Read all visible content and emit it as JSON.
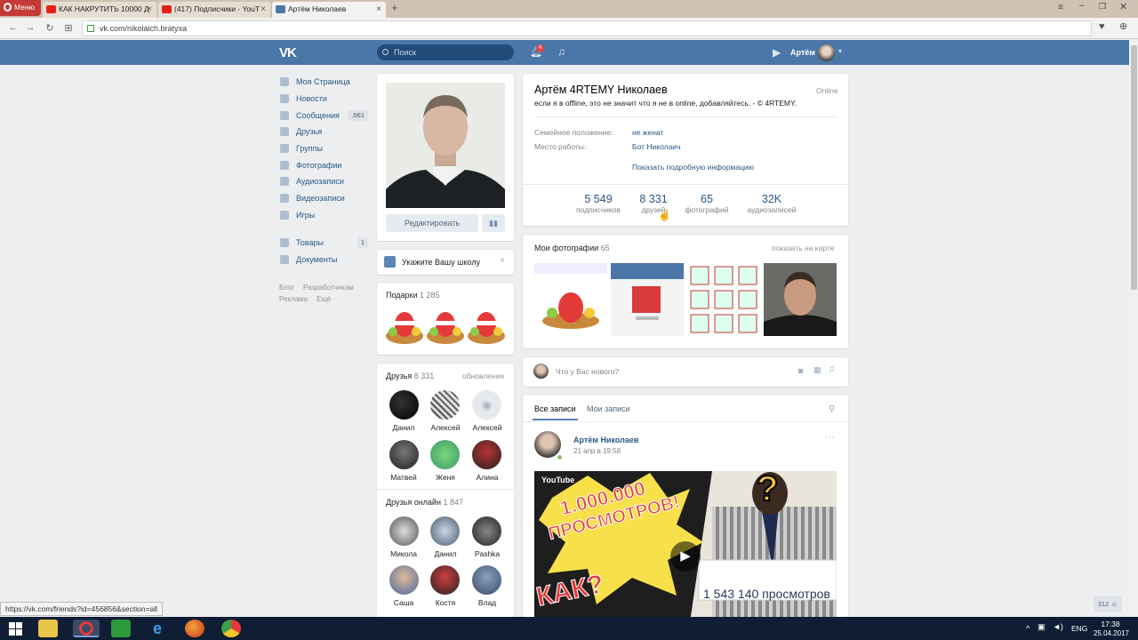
{
  "browser": {
    "menu_label": "Меню",
    "tabs": [
      {
        "title": "КАК НАКРУТИТЬ 10000 Д",
        "icon": "youtube-icon"
      },
      {
        "title": "(417) Подписчики - YouT",
        "icon": "youtube-icon"
      },
      {
        "title": "Артём Николаев",
        "icon": "vk-icon"
      }
    ],
    "url": "vk.com/nikolaich.bratyxa",
    "status_url": "https://vk.com/friends?id=456856&section=all"
  },
  "vk_header": {
    "logo": "VK",
    "search_placeholder": "Поиск",
    "notif_count": "4",
    "user_name": "Артём"
  },
  "left_menu": {
    "items": [
      {
        "label": "Моя Страница",
        "count": ""
      },
      {
        "label": "Новости",
        "count": ""
      },
      {
        "label": "Сообщения",
        "count": ".061"
      },
      {
        "label": "Друзья",
        "count": ""
      },
      {
        "label": "Группы",
        "count": ""
      },
      {
        "label": "Фотографии",
        "count": ""
      },
      {
        "label": "Аудиозаписи",
        "count": ""
      },
      {
        "label": "Видеозаписи",
        "count": ""
      },
      {
        "label": "Игры",
        "count": ""
      }
    ],
    "items2": [
      {
        "label": "Товары",
        "count": "1"
      },
      {
        "label": "Документы",
        "count": ""
      }
    ],
    "footer": [
      "Блог",
      "Разработчикам",
      "Реклама",
      "Ещё ·"
    ]
  },
  "profile": {
    "edit_button": "Редактировать",
    "school_prompt": "Укажите Вашу школу",
    "gifts_title": "Подарки",
    "gifts_count": "1 285",
    "friends_title": "Друзья",
    "friends_count": "8 331",
    "friends_updates": "обновления",
    "friends": [
      "Данил",
      "Алексей",
      "Алексей",
      "Матвей",
      "Женя",
      "Алина"
    ],
    "online_title": "Друзья онлайн",
    "online_count": "1 847",
    "online_friends": [
      "Микола",
      "Данил",
      "Pashka",
      "Саша",
      "Костя",
      "Влад"
    ]
  },
  "info": {
    "name": "Артём 4RTEMY Николаев",
    "online": "Online",
    "status": "если я в offline, это не значит что я не в online, добавляйтесь. - © 4RTEMY.",
    "rows": [
      {
        "label": "Семейное положение:",
        "value": "не женат"
      },
      {
        "label": "Место работы:",
        "value": "Бот Николаич"
      }
    ],
    "more": "Показать подробную информацию",
    "stats": [
      {
        "num": "5 549",
        "label": "подписчиков"
      },
      {
        "num": "8 331",
        "label": "друзей"
      },
      {
        "num": "65",
        "label": "фотографий"
      },
      {
        "num": "32K",
        "label": "аудиозаписей"
      }
    ]
  },
  "photos": {
    "title": "Мои фотографии",
    "count": "65",
    "map_link": "показать на карте"
  },
  "post_box": {
    "placeholder": "Что у Вас нового?"
  },
  "wall": {
    "tab_all": "Все записи",
    "tab_mine": "Мои записи",
    "author": "Артём Николаев",
    "date": "21 апр в 19:58",
    "video_top": "1.000.000",
    "video_mid": "ПРОСМОТРОВ!",
    "video_bottom": "КАК?",
    "video_views": "1 543 140 просмотров",
    "yt": "YouTube"
  },
  "taskbar": {
    "lang": "ENG",
    "time": "17:38",
    "date": "25.04.2017",
    "online_badge": "312"
  },
  "colors": {
    "vk_blue": "#4a76a8",
    "link": "#2a5885",
    "bg": "#edeef0",
    "taskbar": "#0f1e34"
  }
}
